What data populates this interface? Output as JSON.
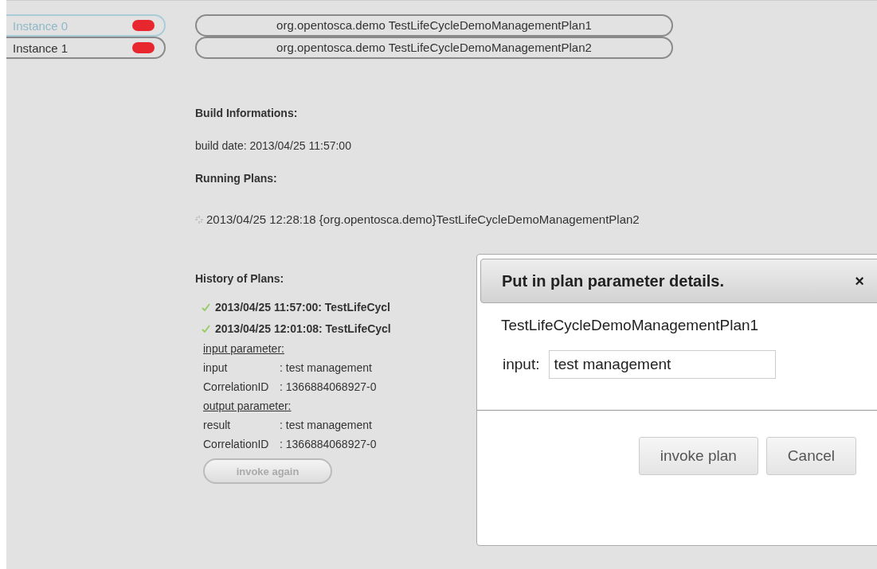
{
  "instances": [
    {
      "label": "Instance 0",
      "selected": true
    },
    {
      "label": "Instance 1",
      "selected": false
    }
  ],
  "plans": [
    "org.opentosca.demo TestLifeCycleDemoManagementPlan1",
    "org.opentosca.demo TestLifeCycleDemoManagementPlan2"
  ],
  "build_heading": "Build Informations:",
  "build_date": "build date: 2013/04/25 11:57:00",
  "running_heading": "Running Plans:",
  "running": [
    {
      "text": "2013/04/25 12:28:18 {org.opentosca.demo}TestLifeCycleDemoManagementPlan2"
    }
  ],
  "history_heading": "History of Plans:",
  "history": [
    {
      "text": "2013/04/25 11:57:00: TestLifeCycl",
      "succeeded": true
    },
    {
      "text": "2013/04/25 12:01:08: TestLifeCycl",
      "succeeded": true
    }
  ],
  "input_heading": "input parameter:",
  "input_params": [
    {
      "name": "input",
      "value": ": test management"
    },
    {
      "name": "CorrelationID",
      "value": ": 1366884068927-0"
    }
  ],
  "output_heading": "output parameter:",
  "output_params": [
    {
      "name": "result",
      "value": ": test management"
    },
    {
      "name": "CorrelationID",
      "value": ": 1366884068927-0"
    }
  ],
  "invoke_again": {
    "label": "invoke again",
    "disabled": true
  },
  "dialog": {
    "title": "Put in plan parameter details.",
    "close": "×",
    "plan": "TestLifeCycleDemoManagementPlan1",
    "fields": [
      {
        "label": "input:",
        "value": "test management"
      }
    ],
    "buttons": [
      "invoke plan",
      "Cancel"
    ]
  }
}
